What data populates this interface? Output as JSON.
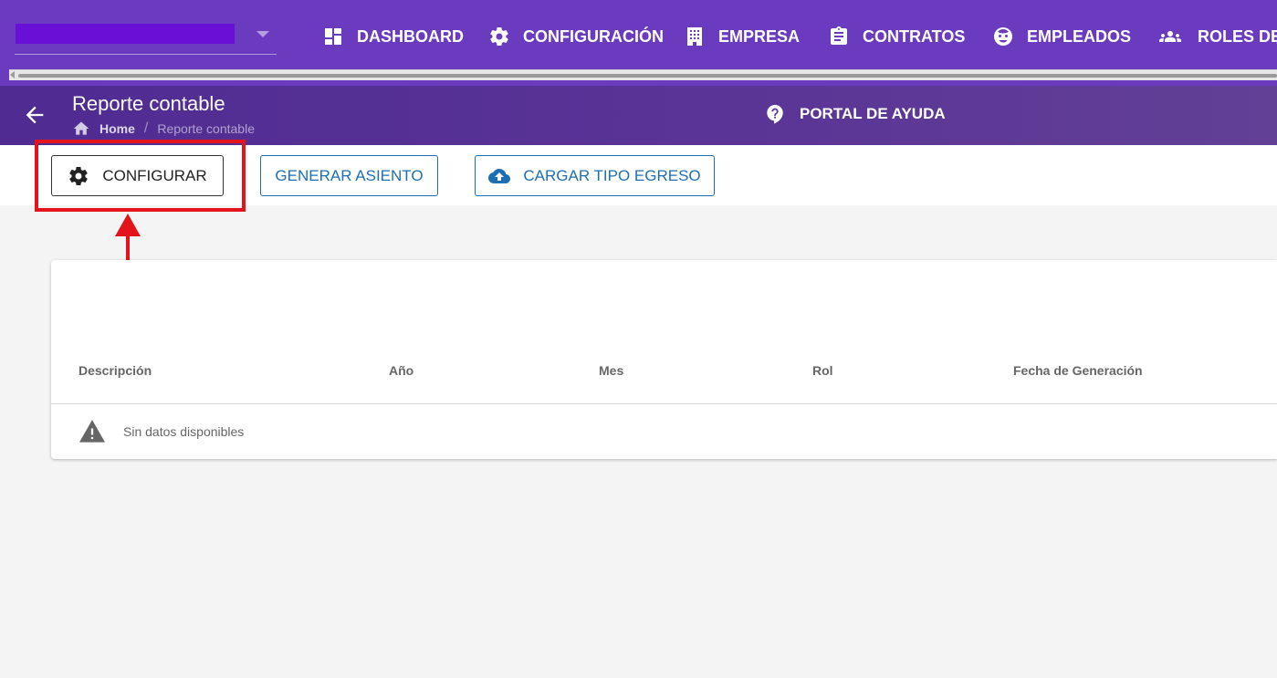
{
  "nav": {
    "items": [
      {
        "label": "DASHBOARD",
        "icon": "dashboard-icon"
      },
      {
        "label": "CONFIGURACIÓN",
        "icon": "gear-icon"
      },
      {
        "label": "EMPRESA",
        "icon": "building-icon"
      },
      {
        "label": "CONTRATOS",
        "icon": "clipboard-icon"
      },
      {
        "label": "EMPLEADOS",
        "icon": "face-icon"
      },
      {
        "label": "ROLES DE P",
        "icon": "people-icon"
      }
    ]
  },
  "header": {
    "title": "Reporte contable",
    "breadcrumb_home": "Home",
    "breadcrumb_separator": "/",
    "breadcrumb_current": "Reporte contable",
    "help_label": "PORTAL DE AYUDA"
  },
  "toolbar": {
    "configurar_label": "CONFIGURAR",
    "generar_asiento_label": "GENERAR ASIENTO",
    "cargar_tipo_egreso_label": "CARGAR TIPO EGRESO"
  },
  "table": {
    "columns": [
      "Descripción",
      "Año",
      "Mes",
      "Rol",
      "Fecha de Generación"
    ],
    "empty_message": "Sin datos disponibles"
  },
  "colors": {
    "topbar": "#6a3bbf",
    "subheader": "#54308f",
    "accent_blue": "#1c6fb5",
    "annotation_red": "#e3141b"
  }
}
